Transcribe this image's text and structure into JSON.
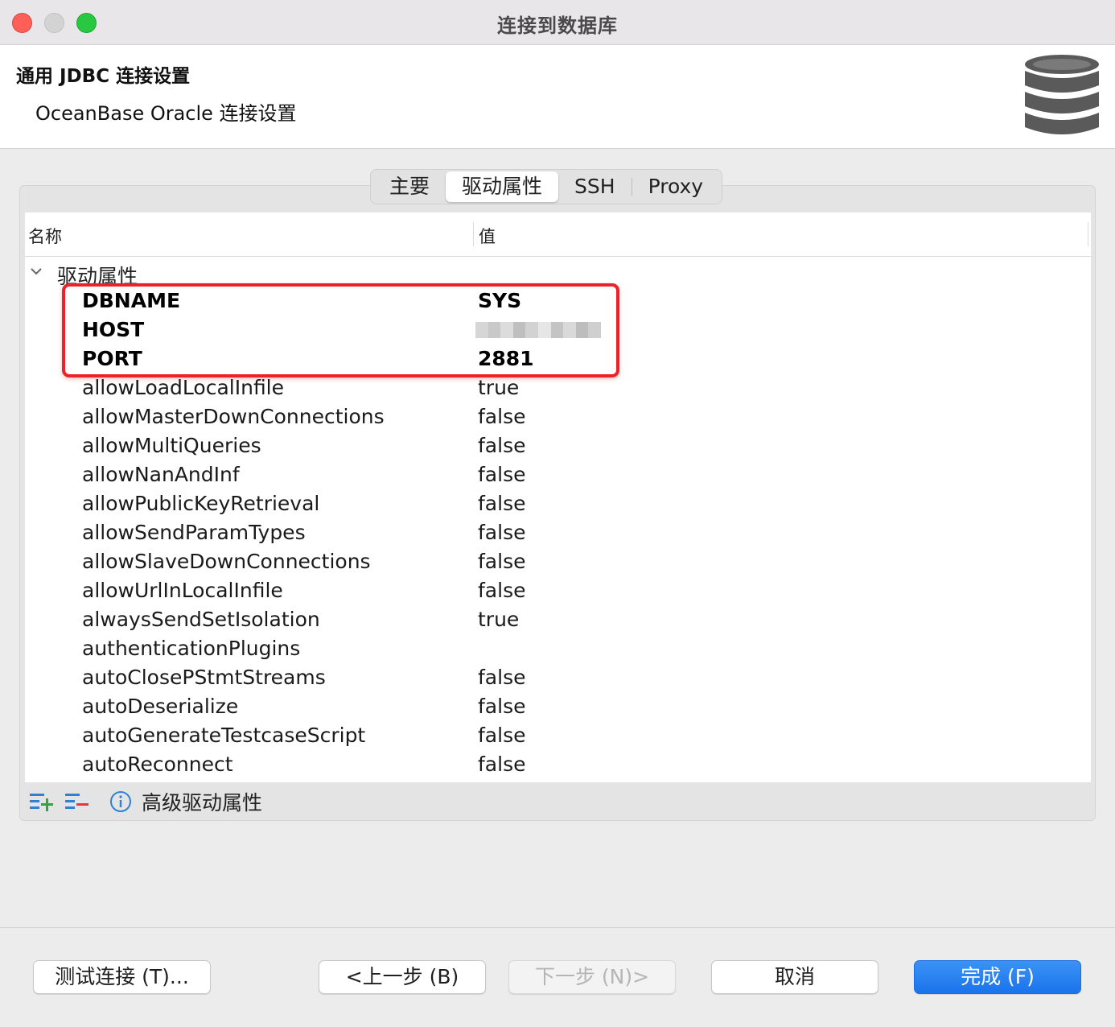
{
  "window": {
    "title": "连接到数据库"
  },
  "header": {
    "title": "通用 JDBC 连接设置",
    "subtitle": "OceanBase Oracle 连接设置",
    "icon": "database-icon"
  },
  "tabs": [
    {
      "label": "主要",
      "active": false
    },
    {
      "label": "驱动属性",
      "active": true
    },
    {
      "label": "SSH",
      "active": false
    },
    {
      "label": "Proxy",
      "active": false
    }
  ],
  "table": {
    "columns": [
      "名称",
      "值"
    ],
    "group_label": "驱动属性",
    "rows": [
      {
        "name": "DBNAME",
        "value": "SYS",
        "bold": true
      },
      {
        "name": "HOST",
        "value": "",
        "bold": true,
        "redacted": true
      },
      {
        "name": "PORT",
        "value": "2881",
        "bold": true
      },
      {
        "name": "allowLoadLocalInfile",
        "value": "true"
      },
      {
        "name": "allowMasterDownConnections",
        "value": "false"
      },
      {
        "name": "allowMultiQueries",
        "value": "false"
      },
      {
        "name": "allowNanAndInf",
        "value": "false"
      },
      {
        "name": "allowPublicKeyRetrieval",
        "value": "false"
      },
      {
        "name": "allowSendParamTypes",
        "value": "false"
      },
      {
        "name": "allowSlaveDownConnections",
        "value": "false"
      },
      {
        "name": "allowUrlInLocalInfile",
        "value": "false"
      },
      {
        "name": "alwaysSendSetIsolation",
        "value": "true"
      },
      {
        "name": "authenticationPlugins",
        "value": ""
      },
      {
        "name": "autoClosePStmtStreams",
        "value": "false"
      },
      {
        "name": "autoDeserialize",
        "value": "false"
      },
      {
        "name": "autoGenerateTestcaseScript",
        "value": "false"
      },
      {
        "name": "autoReconnect",
        "value": "false"
      }
    ]
  },
  "tools": {
    "add_icon": "add-property-icon",
    "remove_icon": "remove-property-icon",
    "info_icon": "info-icon",
    "advanced_label": "高级驱动属性"
  },
  "buttons": {
    "test": "测试连接 (T)...",
    "back": "<上一步 (B)",
    "next": "下一步 (N)>",
    "cancel": "取消",
    "finish": "完成 (F)"
  },
  "colors": {
    "highlight": "#f0202a",
    "primary_button": "#1a73ea"
  }
}
